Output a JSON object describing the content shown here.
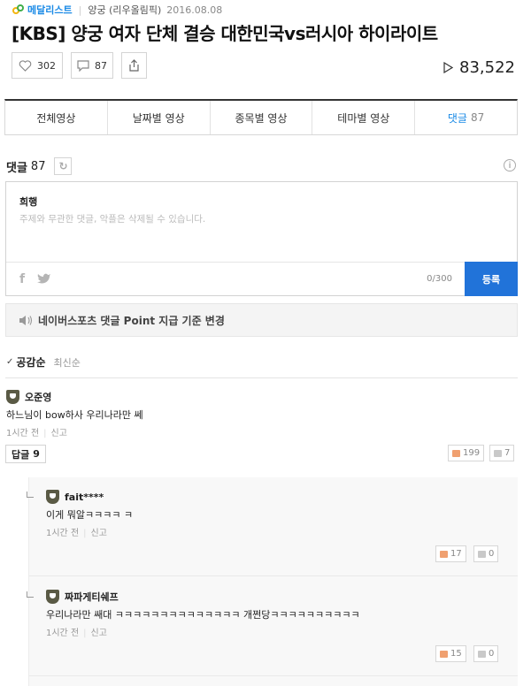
{
  "header": {
    "brand": "메달리스트",
    "category": "양궁 (리우올림픽)",
    "date": "2016.08.08",
    "title": "[KBS] 양궁 여자 단체 결승 대한민국vs러시아 하이라이트",
    "like_count": "302",
    "comment_count": "87",
    "view_count": "83,522"
  },
  "tabs": [
    {
      "label": "전체영상",
      "count": ""
    },
    {
      "label": "날짜별 영상",
      "count": ""
    },
    {
      "label": "종목별 영상",
      "count": ""
    },
    {
      "label": "테마별 영상",
      "count": ""
    },
    {
      "label": "댓글",
      "count": "87"
    }
  ],
  "comments_section": {
    "heading": "댓글",
    "count": "87",
    "info": "i"
  },
  "compose": {
    "username": "희행",
    "placeholder": "주제와 무관한 댓글, 악플은 삭제될 수 있습니다.",
    "counter": "0/300",
    "submit": "등록"
  },
  "notice": "네이버스포츠 댓글 Point 지급 기준 변경",
  "sort": {
    "active": "공감순",
    "inactive": "최신순"
  },
  "comment": {
    "author": "오준영",
    "text": "하느님이 bow하사 우리나라만 쎄",
    "time": "1시간 전",
    "report": "신고",
    "reply_label": "답글",
    "reply_count": "9",
    "likes": "199",
    "dislikes": "7"
  },
  "replies": [
    {
      "author": "fait****",
      "text": "이게 뭐알ㅋㅋㅋㅋ ㅋ",
      "time": "1시간 전",
      "report": "신고",
      "likes": "17",
      "dislikes": "0"
    },
    {
      "author": "짜파게티쉐프",
      "text": "우리나라만 쌔대 ㅋㅋㅋㅋㅋㅋㅋㅋㅋㅋㅋㅋㅋㅋ 개쩐당ㅋㅋㅋㅋㅋㅋㅋㅋㅋㅋ",
      "time": "1시간 전",
      "report": "신고",
      "likes": "15",
      "dislikes": "0"
    }
  ]
}
